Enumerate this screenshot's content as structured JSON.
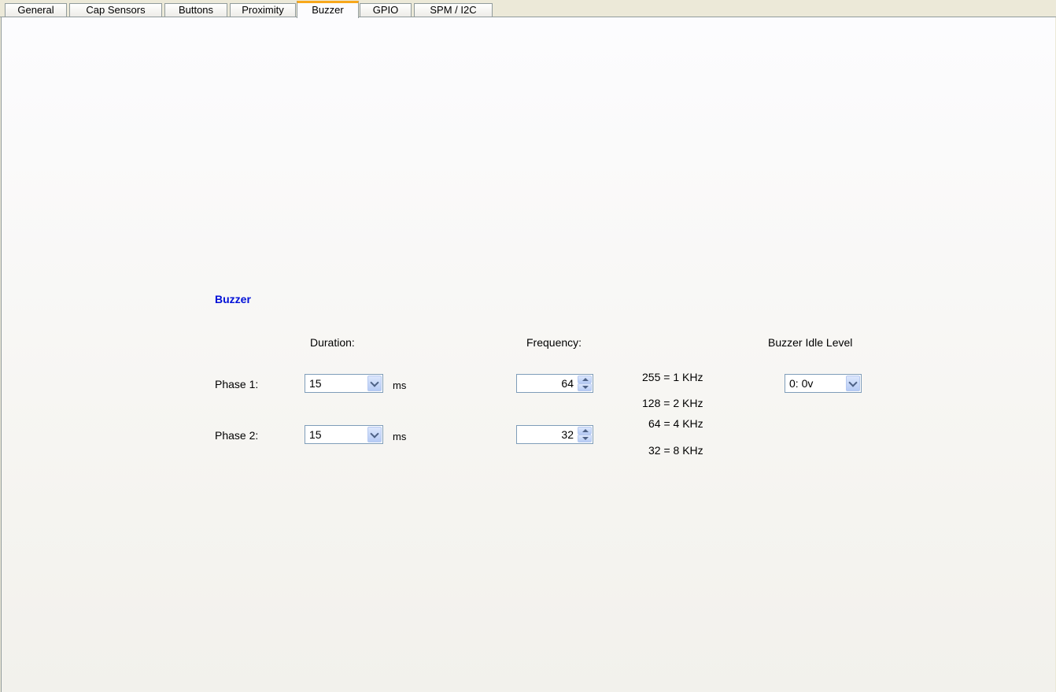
{
  "tabs": [
    {
      "label": "General"
    },
    {
      "label": "Cap Sensors"
    },
    {
      "label": "Buttons"
    },
    {
      "label": "Proximity"
    },
    {
      "label": "Buzzer",
      "active": true
    },
    {
      "label": "GPIO"
    },
    {
      "label": "SPM / I2C"
    }
  ],
  "buzzer": {
    "title": "Buzzer",
    "duration_header": "Duration:",
    "frequency_header": "Frequency:",
    "idle_header": "Buzzer Idle Level",
    "phase1": {
      "label": "Phase 1:",
      "duration": "15",
      "unit": "ms",
      "frequency": "64"
    },
    "phase2": {
      "label": "Phase 2:",
      "duration": "15",
      "unit": "ms",
      "frequency": "32"
    },
    "freq_legend": [
      "255 = 1 KHz",
      "128 = 2 KHz",
      "64 = 4 KHz",
      "32 = 8 KHz"
    ],
    "idle_level": "0: 0v"
  },
  "colors": {
    "title_blue": "#0010d8",
    "active_tab_accent": "#f8a81c",
    "field_border": "#7f9db9"
  }
}
